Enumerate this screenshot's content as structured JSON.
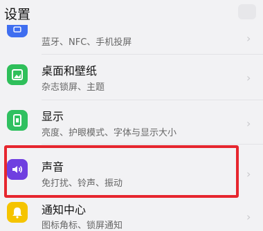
{
  "header": {
    "title": "设置"
  },
  "items": [
    {
      "subtitle": "蓝牙、NFC、手机投屏",
      "icon": "connection-icon",
      "icon_color": "#3f6ef0"
    },
    {
      "title": "桌面和壁纸",
      "subtitle": "杂志锁屏、主题",
      "icon": "wallpaper-icon",
      "icon_color": "#2fbf5a"
    },
    {
      "title": "显示",
      "subtitle": "亮度、护眼模式、字体与显示大小",
      "icon": "display-icon",
      "icon_color": "#30c060"
    },
    {
      "title": "声音",
      "subtitle": "免打扰、铃声、振动",
      "icon": "speaker-icon",
      "icon_color": "#6f3fe0"
    },
    {
      "title": "通知中心",
      "subtitle": "图标角标、锁屏通知",
      "icon": "bell-icon",
      "icon_color": "#f5c400"
    }
  ],
  "chevron": "›",
  "highlight_color": "#e6262e"
}
